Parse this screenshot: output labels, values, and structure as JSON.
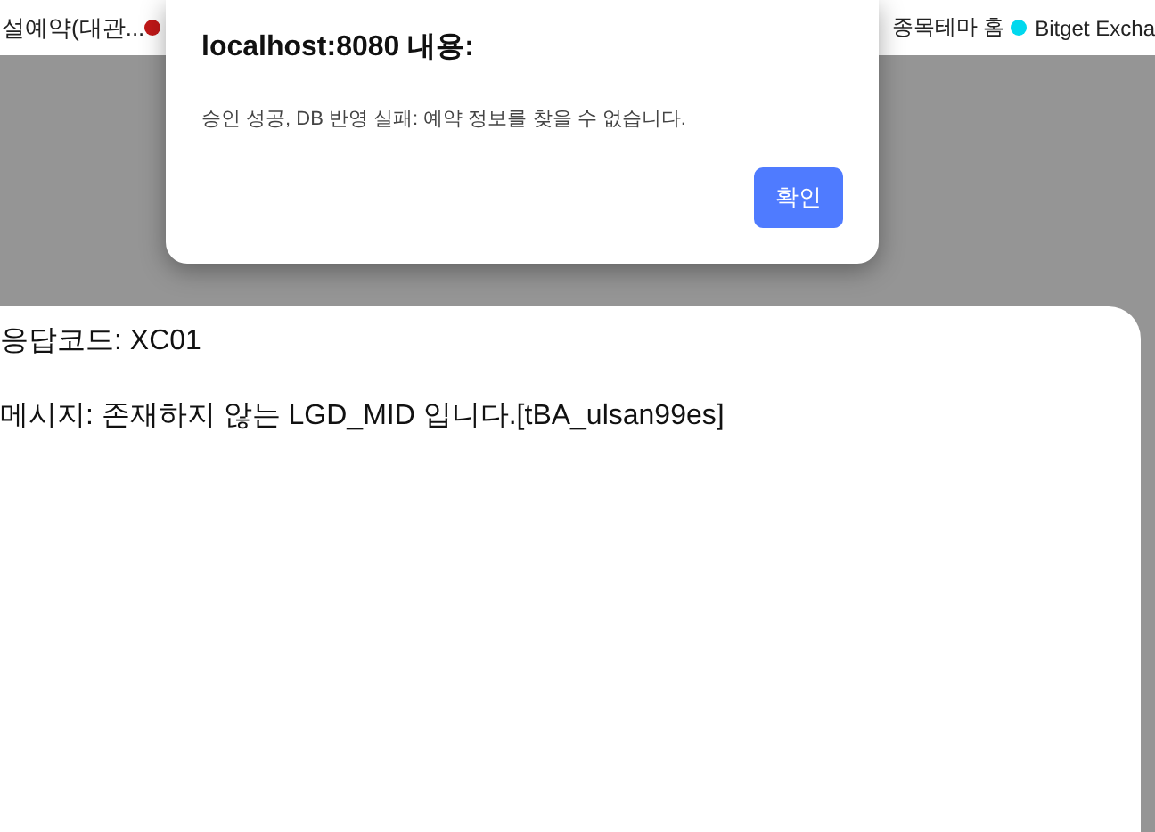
{
  "bookmarks": [
    {
      "label": "설예약(대관..."
    },
    {
      "color": "#c01818"
    },
    {
      "label": "종목테마 홈"
    },
    {
      "label": "Bitget Excha",
      "color": "#00d8ee"
    }
  ],
  "page": {
    "lines": [
      "응답코드: XC01",
      "메시지: 존재하지 않는 LGD_MID 입니다.[tBA_ulsan99es]"
    ]
  },
  "dialog": {
    "title": "localhost:8080 내용:",
    "message": "승인 성공, DB 반영 실패: 예약 정보를 찾을 수 없습니다.",
    "button": "확인"
  }
}
